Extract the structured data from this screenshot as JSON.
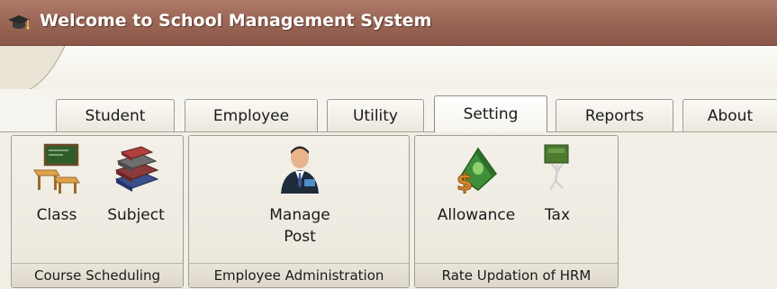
{
  "window": {
    "title": "Welcome to School Management System",
    "icon": "graduation-cap-icon"
  },
  "tabs": [
    {
      "label": "Student",
      "active": false
    },
    {
      "label": "Employee",
      "active": false
    },
    {
      "label": "Utility",
      "active": false
    },
    {
      "label": "Setting",
      "active": true
    },
    {
      "label": "Reports",
      "active": false
    },
    {
      "label": "About",
      "active": false
    }
  ],
  "groups": [
    {
      "label": "Course Scheduling",
      "buttons": [
        {
          "label": "Class",
          "icon": "classroom-icon"
        },
        {
          "label": "Subject",
          "icon": "books-icon"
        }
      ]
    },
    {
      "label": "Employee Administration",
      "buttons": [
        {
          "label_line1": "Manage",
          "label_line2": "Post",
          "icon": "businessman-icon"
        }
      ]
    },
    {
      "label": "Rate Updation of HRM",
      "buttons": [
        {
          "label": "Allowance",
          "icon": "money-allowance-icon"
        },
        {
          "label": "Tax",
          "icon": "tax-burden-icon"
        }
      ]
    }
  ],
  "colors": {
    "titlebar": "#9c6757",
    "ribbon_background": "#f1eee5",
    "active_tab": "#ffffff"
  }
}
